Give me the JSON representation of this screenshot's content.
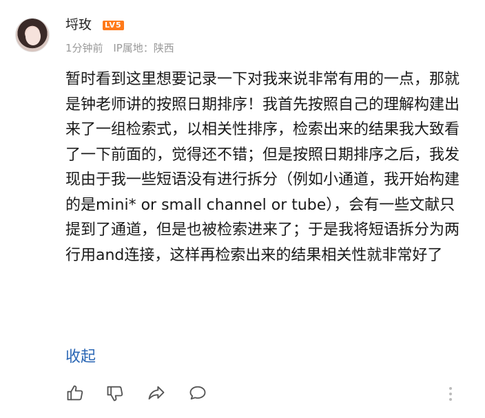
{
  "comment": {
    "author": "埒玫",
    "level_badge": "LV5",
    "time": "1分钟前",
    "ip_location": "IP属地：陕西",
    "body": "暂时看到这里想要记录一下对我来说非常有用的一点，那就是钟老师讲的按照日期排序！我首先按照自己的理解构建出来了一组检索式，以相关性排序，检索出来的结果我大致看了一下前面的，觉得还不错；但是按照日期排序之后，我发现由于我一些短语没有进行拆分（例如小通道，我开始构建的是mini* or small channel or tube），会有一些文献只提到了通道，但是也被检索进来了；于是我将短语拆分为两行用and连接，这样再检索出来的结果相关性就非常好了",
    "collapse_label": "收起"
  },
  "colors": {
    "level_badge": "#ff7a1a",
    "link": "#2b67b5",
    "meta": "#999999"
  },
  "icons": [
    "thumbs-up-icon",
    "thumbs-down-icon",
    "share-icon",
    "comment-icon",
    "more-icon"
  ]
}
